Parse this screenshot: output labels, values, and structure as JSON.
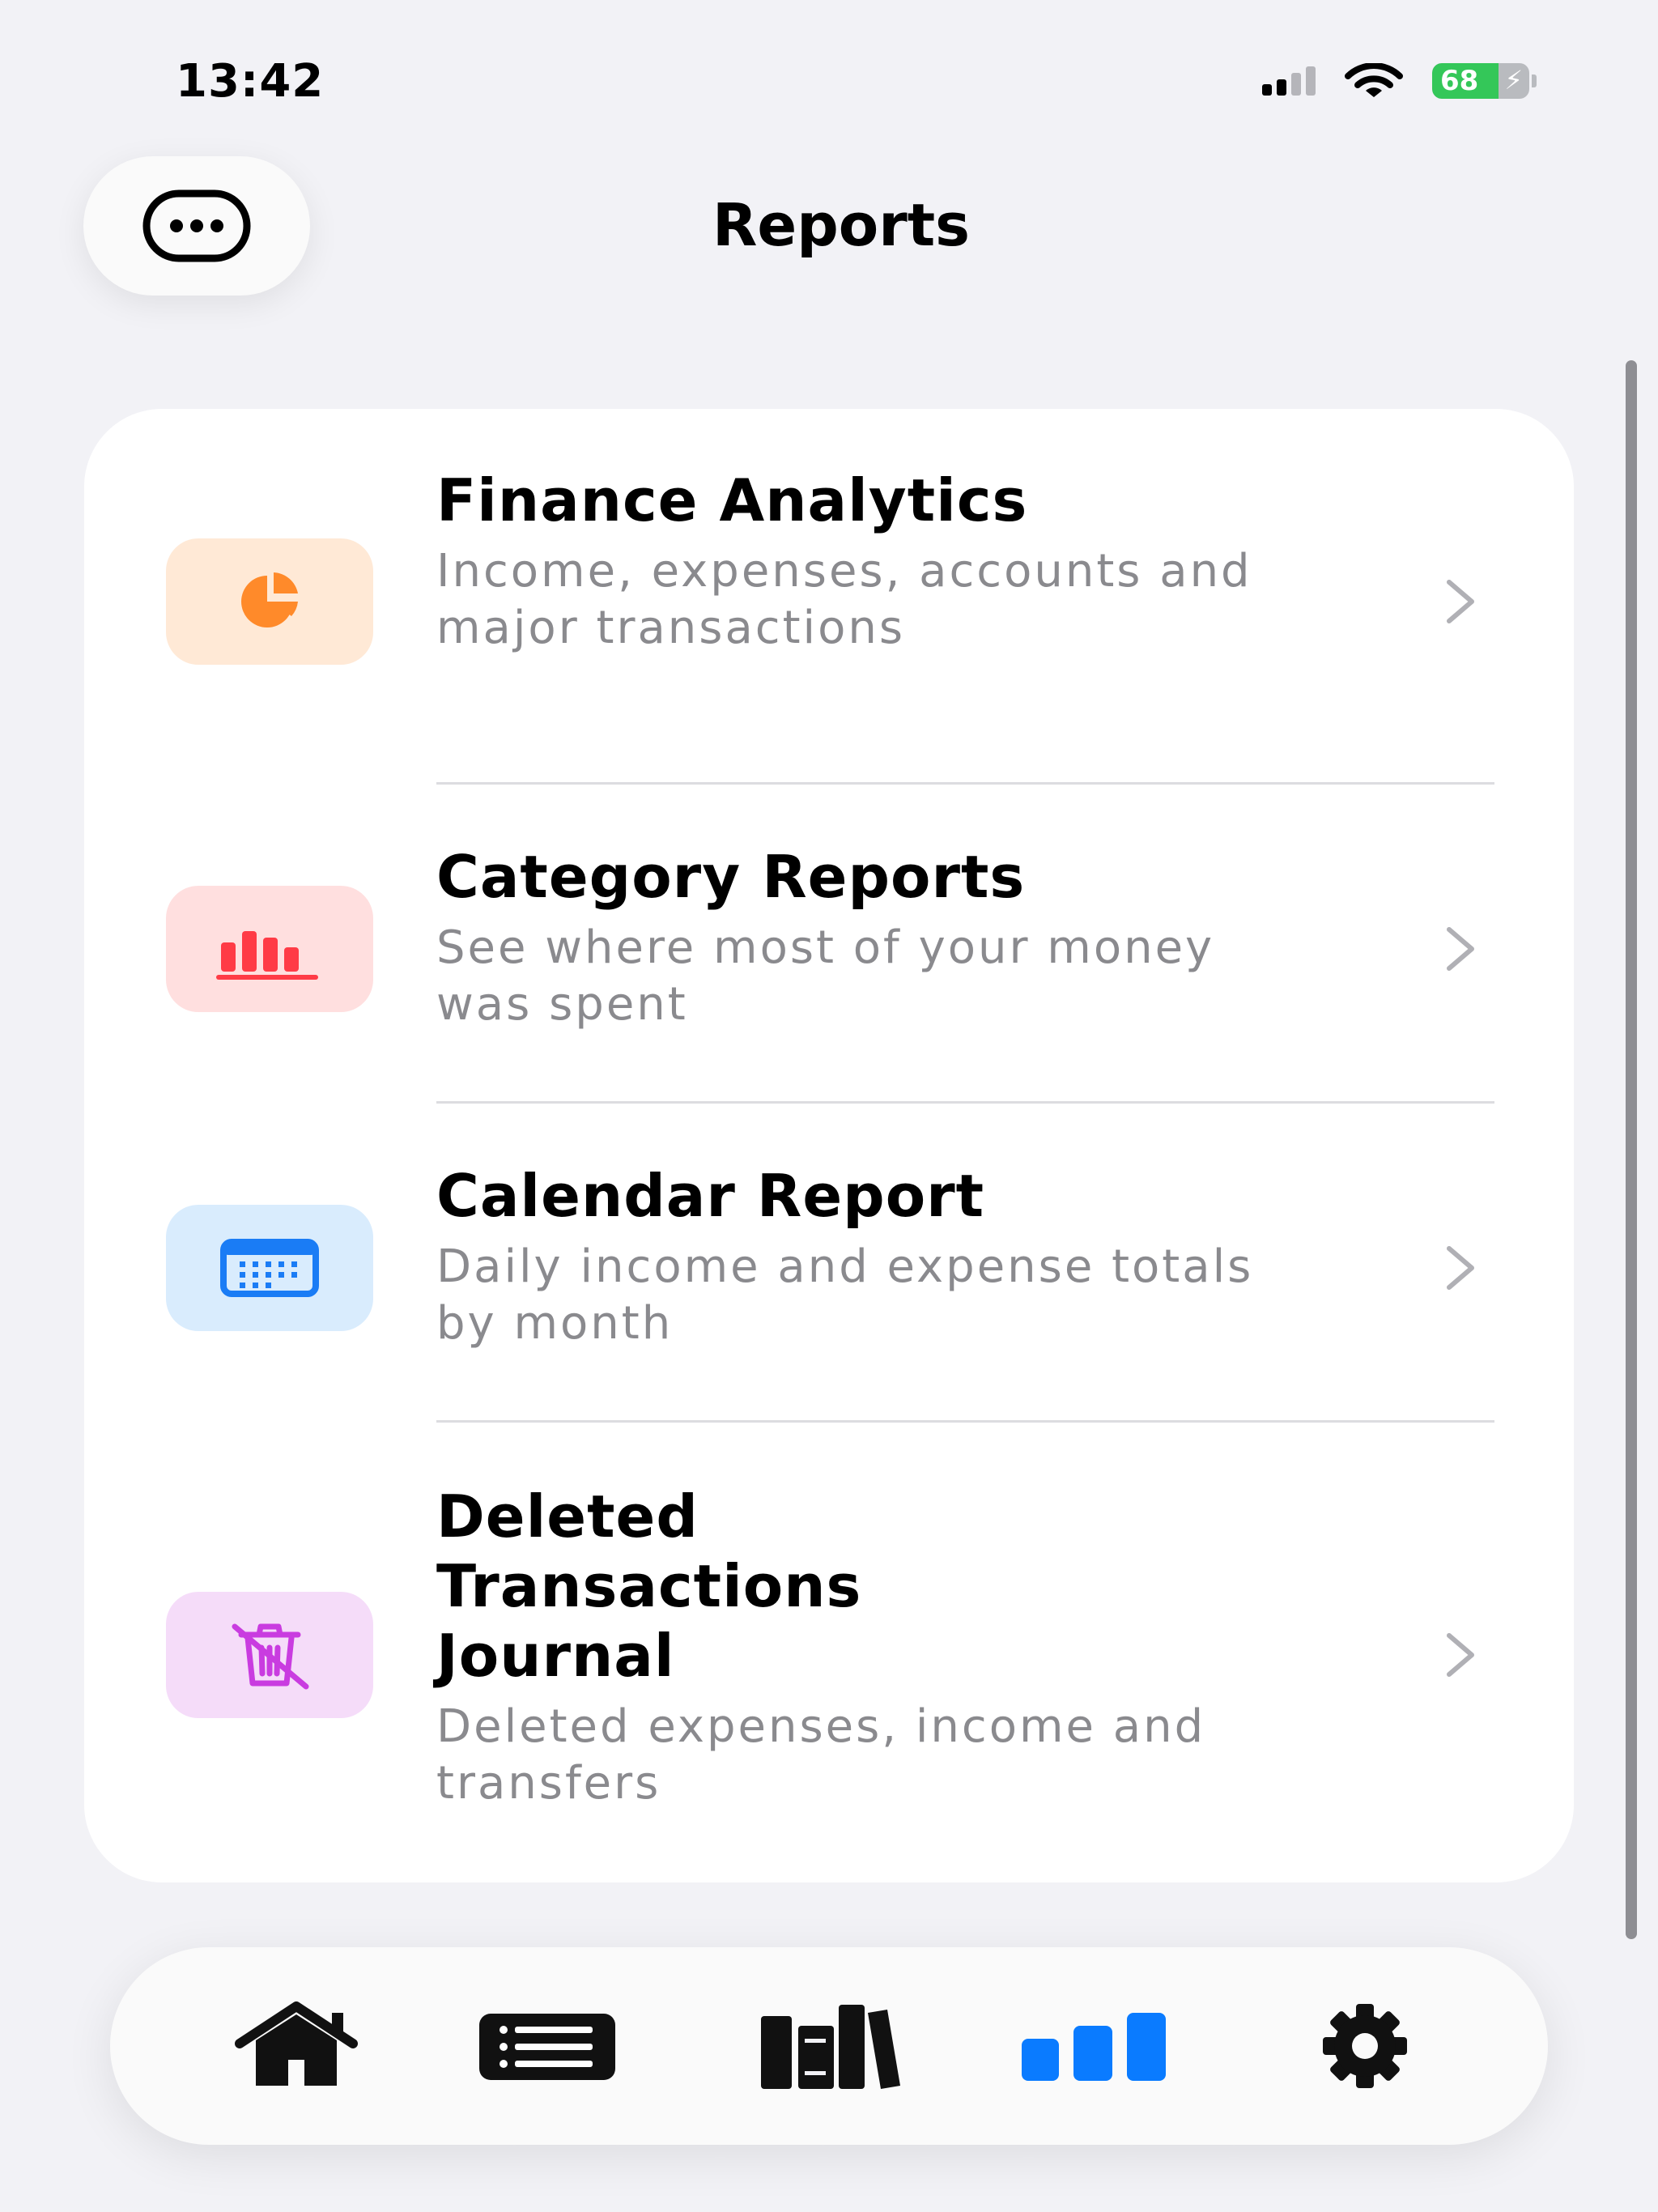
{
  "status_bar": {
    "time": "13:42",
    "battery_level": "68",
    "battery_fraction": 0.68,
    "signal_bars_active": 2,
    "signal_bars_total": 4,
    "icons": [
      "cellular-signal-icon",
      "wifi-icon",
      "battery-charging-icon"
    ]
  },
  "header": {
    "title": "Reports",
    "more_icon": "ellipsis-circle-icon"
  },
  "reports": [
    {
      "title": "Finance Analytics",
      "subtitle": "Income, expenses, accounts and major transactions",
      "icon": "pie-chart-icon",
      "icon_color": "#ff8a2a",
      "icon_bg": "#ffe9d6"
    },
    {
      "title": "Category Reports",
      "subtitle": "See where most of your money was spent",
      "icon": "bar-chart-icon",
      "icon_color": "#ff3b46",
      "icon_bg": "#ffdfdf"
    },
    {
      "title": "Calendar Report",
      "subtitle": "Daily income and expense totals by month",
      "icon": "calendar-icon",
      "icon_color": "#1a7cf5",
      "icon_bg": "#d9ecfd"
    },
    {
      "title": "Deleted Transactions Journal",
      "subtitle": "Deleted expenses, income and transfers",
      "icon": "trash-slash-icon",
      "icon_color": "#c93ce0",
      "icon_bg": "#f5dcf9"
    }
  ],
  "tab_bar": {
    "tabs": [
      {
        "icon": "home-icon",
        "active": false
      },
      {
        "icon": "list-icon",
        "active": false
      },
      {
        "icon": "books-icon",
        "active": false
      },
      {
        "icon": "bar-chart-icon",
        "active": true
      },
      {
        "icon": "gear-icon",
        "active": false
      }
    ],
    "active_color": "#0a7bff"
  }
}
